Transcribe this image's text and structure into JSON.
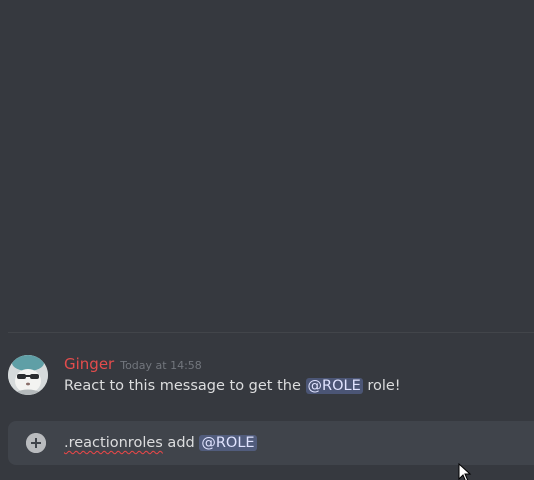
{
  "message": {
    "username": "Ginger",
    "timestamp": "Today at 14:58",
    "text_before": "React to this message to get the ",
    "mention": "@ROLE",
    "text_after": " role!",
    "username_color": "#e34c4c"
  },
  "composer": {
    "command": ".reactionroles",
    "argument": " add ",
    "mention": "@ROLE"
  },
  "icons": {
    "attach": "plus-circle-icon",
    "avatar": "avatar-cat-icon",
    "cursor": "mouse-pointer-icon"
  },
  "colors": {
    "background": "#36393f",
    "composer_bg": "#40444b",
    "mention_bg": "#4e5a9b",
    "text": "#dcddde",
    "muted": "#72767d"
  }
}
